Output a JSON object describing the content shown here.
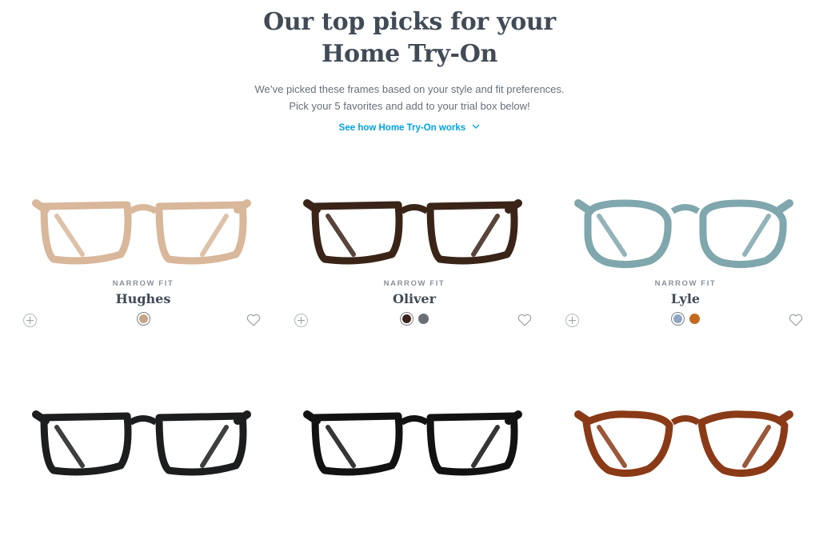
{
  "header": {
    "title_line1": "Our top picks for your",
    "title_line2": "Home Try-On",
    "subtitle_line1": "We’ve picked these frames based on your style and fit preferences.",
    "subtitle_line2": "Pick your 5 favorites and add to your trial box below!",
    "how_link": "See how Home Try-On works",
    "link_color": "#00a2e1"
  },
  "products": [
    {
      "fit": "NARROW FIT",
      "name": "Hughes",
      "frame_color": "#d8b79a",
      "swatches": [
        "#c9a486"
      ]
    },
    {
      "fit": "NARROW FIT",
      "name": "Oliver",
      "frame_color": "#3a2418",
      "swatches": [
        "#3a2418",
        "#6a6f75"
      ]
    },
    {
      "fit": "NARROW FIT",
      "name": "Lyle",
      "frame_color": "#7fa7ad",
      "swatches": [
        "#8ea6c4",
        "#c26a1e"
      ]
    },
    {
      "fit": "",
      "name": "",
      "frame_color": "#1c1d1f",
      "swatches": []
    },
    {
      "fit": "",
      "name": "",
      "frame_color": "#121212",
      "swatches": []
    },
    {
      "fit": "",
      "name": "",
      "frame_color": "#8a3a17",
      "swatches": []
    }
  ],
  "icons": {
    "add": "plus-circle-icon",
    "favorite": "heart-icon",
    "chevron": "chevron-down-icon"
  }
}
